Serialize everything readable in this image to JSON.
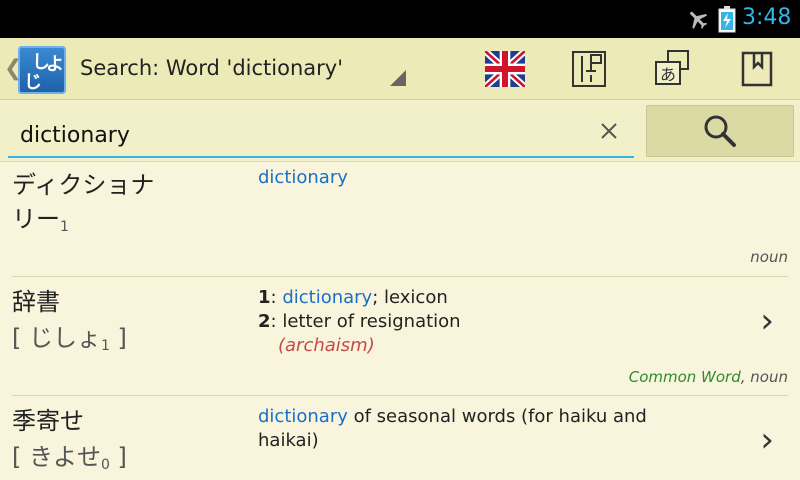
{
  "status": {
    "time": "3:48",
    "icons": [
      "airplane-mode-icon",
      "battery-charging-icon"
    ]
  },
  "actionbar": {
    "logo_chars": [
      "じ",
      "し",
      "よ"
    ],
    "title": "Search: Word 'dictionary'",
    "buttons": [
      "english-flag-icon",
      "vertical-text-icon",
      "translate-icon",
      "bookmark-icon"
    ]
  },
  "search": {
    "value": "dictionary",
    "clear_icon": "close-icon",
    "search_icon": "search-icon"
  },
  "results": [
    {
      "kanji_line1": "ディクショナ",
      "kanji_line2": "リー",
      "kanji_sub": "1",
      "definitions": [
        {
          "text": "dictionary"
        }
      ],
      "pos": "noun"
    },
    {
      "kanji": "辞書",
      "reading_open": "[ ",
      "reading": "じしょ",
      "reading_sub": "1",
      "reading_close": " ]",
      "def1_num": "1",
      "def1_link": "dictionary",
      "def1_rest": "; lexicon",
      "def2_num": "2",
      "def2_text": "letter of resignation",
      "def2_note": "(archaism)",
      "common": "Common Word",
      "pos": "noun"
    },
    {
      "kanji": "季寄せ",
      "reading_open": "[ ",
      "reading": "きよせ",
      "reading_sub": "0",
      "reading_close": " ]",
      "def_link": "dictionary",
      "def_rest": " of seasonal words (for haiku and",
      "def_line2": "haikai)"
    }
  ],
  "colors": {
    "accent": "#33b5e5",
    "link": "#1a6fc9",
    "archaism": "#c44a4a",
    "common": "#2f8a2f",
    "background": "#f8f5dc"
  }
}
